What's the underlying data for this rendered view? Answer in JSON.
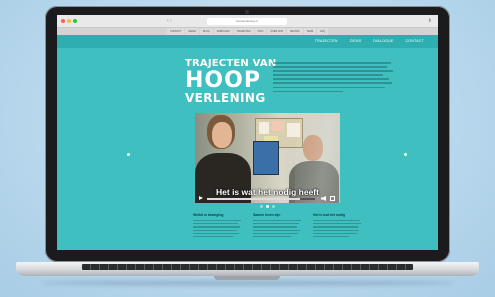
{
  "browser": {
    "url": "hoopverlening.nl",
    "tabs": [
      "CONTACT",
      "MEDIA",
      "BLOG",
      "VERHALEN",
      "TRAJECTEN",
      "INFO",
      "OVER ONS",
      "NIEUWS",
      "TEAM",
      "FAQ"
    ]
  },
  "site": {
    "nav": [
      "TRAJECTEN",
      "ZIENS",
      "DIALOGUE",
      "CONTACT"
    ],
    "title_line1": "TRAJECTEN VAN",
    "title_line2": "HOOP",
    "title_line3": "VERLENING"
  },
  "video": {
    "subtitle": "Het is wat het nodig heeft",
    "progress": 0.86
  },
  "columns": [
    {
      "heading": "Welkit in beweging"
    },
    {
      "heading": "Samen leven zijn"
    },
    {
      "heading": "Het is wat het nodig"
    }
  ],
  "colors": {
    "accent": "#3fbfbf",
    "nav": "#2eaeb0"
  },
  "icons": [
    "play-icon",
    "volume-icon",
    "fullscreen-icon",
    "close-dot-icon",
    "minimize-dot-icon",
    "maximize-dot-icon"
  ]
}
